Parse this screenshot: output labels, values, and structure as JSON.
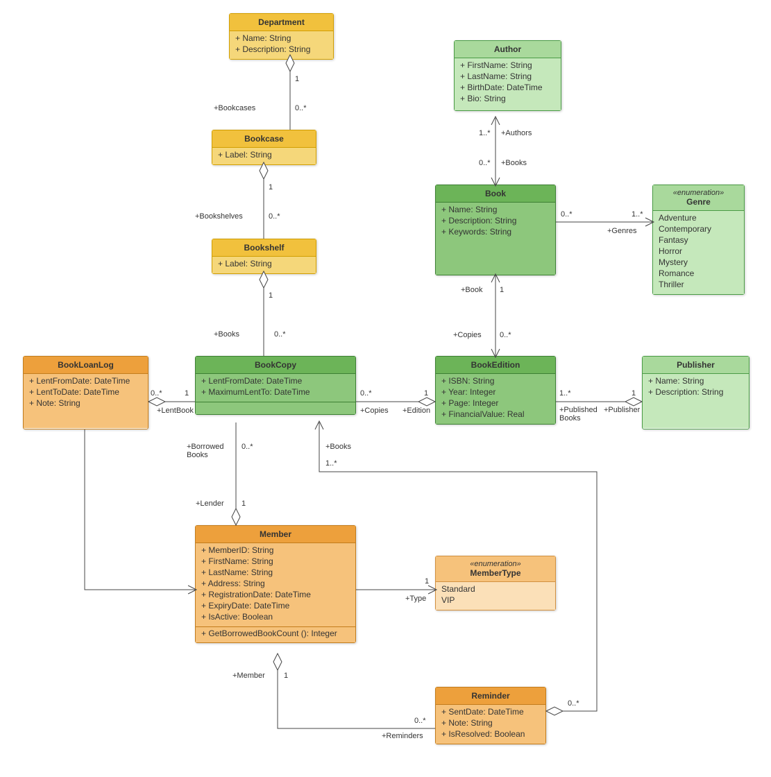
{
  "classes": {
    "Department": {
      "title": "Department",
      "attrs": [
        "+ Name: String",
        "+ Description: String"
      ]
    },
    "Bookcase": {
      "title": "Bookcase",
      "attrs": [
        "+ Label: String"
      ]
    },
    "Bookshelf": {
      "title": "Bookshelf",
      "attrs": [
        "+ Label: String"
      ]
    },
    "BookCopy": {
      "title": "BookCopy",
      "attrs": [
        "+ LentFromDate: DateTime",
        "+ MaximumLentTo: DateTime"
      ]
    },
    "BookLoanLog": {
      "title": "BookLoanLog",
      "attrs": [
        "+ LentFromDate: DateTime",
        "+ LentToDate: DateTime",
        "+ Note: String"
      ]
    },
    "Author": {
      "title": "Author",
      "attrs": [
        "+ FirstName: String",
        "+ LastName: String",
        "+ BirthDate: DateTime",
        "+ Bio: String"
      ]
    },
    "Book": {
      "title": "Book",
      "attrs": [
        "+ Name: String",
        "+ Description: String",
        "+ Keywords: String"
      ]
    },
    "BookEdition": {
      "title": "BookEdition",
      "attrs": [
        "+ ISBN: String",
        "+ Year: Integer",
        "+ Page: Integer",
        "+ FinancialValue: Real"
      ]
    },
    "Genre": {
      "title": "Genre",
      "stereo": "«enumeration»",
      "attrs": [
        "Adventure",
        "Contemporary",
        "Fantasy",
        "Horror",
        "Mystery",
        "Romance",
        "Thriller"
      ]
    },
    "Publisher": {
      "title": "Publisher",
      "attrs": [
        "+ Name: String",
        "+ Description: String"
      ]
    },
    "Member": {
      "title": "Member",
      "attrs": [
        "+ MemberID: String",
        "+ FirstName: String",
        "+ LastName: String",
        "+ Address: String",
        "+ RegistrationDate: DateTime",
        "+ ExpiryDate: DateTime",
        "+ IsActive: Boolean"
      ],
      "ops": [
        "+ GetBorrowedBookCount (): Integer"
      ]
    },
    "MemberType": {
      "title": "MemberType",
      "stereo": "«enumeration»",
      "attrs": [
        "Standard",
        "VIP"
      ]
    },
    "Reminder": {
      "title": "Reminder",
      "attrs": [
        "+ SentDate: DateTime",
        "+ Note: String",
        "+ IsResolved: Boolean"
      ]
    }
  },
  "labels": {
    "dep_bc_1": "1",
    "dep_bc_m": "0..*",
    "dep_bc_r": "+Bookcases",
    "bc_bs_1": "1",
    "bc_bs_m": "0..*",
    "bc_bs_r": "+Bookshelves",
    "bs_cp_1": "1",
    "bs_cp_m": "0..*",
    "bs_cp_r": "+Books",
    "log_cp_m": "0..*",
    "log_cp_1": "1",
    "log_cp_r": "+LentBook",
    "cp_ed_m": "0..*",
    "cp_ed_1": "1",
    "cp_ed_rC": "+Copies",
    "cp_ed_rE": "+Edition",
    "bk_au_m1": "1..*",
    "bk_au_rA": "+Authors",
    "bk_au_m2": "0..*",
    "bk_au_rB": "+Books",
    "bk_ge_m1": "0..*",
    "bk_ge_m2": "1..*",
    "bk_ge_r": "+Genres",
    "ed_bk_1": "1",
    "ed_bk_m": "0..*",
    "ed_bk_rB": "+Book",
    "ed_bk_rC": "+Copies",
    "ed_pub_m": "1..*",
    "ed_pub_1": "1",
    "ed_pub_rPB": "+Published\nBooks",
    "ed_pub_rP": "+Publisher",
    "mem_cp_m": "0..*",
    "mem_cp_1": "1",
    "mem_cp_rB": "+Borrowed\nBooks",
    "mem_cp_rL": "+Lender",
    "mem_bk_m": "1..*",
    "mem_bk_r": "+Books",
    "mem_mt_1": "1",
    "mem_mt_r": "+Type",
    "mem_rem_1": "1",
    "mem_rem_m": "0..*",
    "mem_rem_rM": "+Member",
    "mem_rem_rR": "+Reminders",
    "rem_cp_m": "0..*"
  }
}
